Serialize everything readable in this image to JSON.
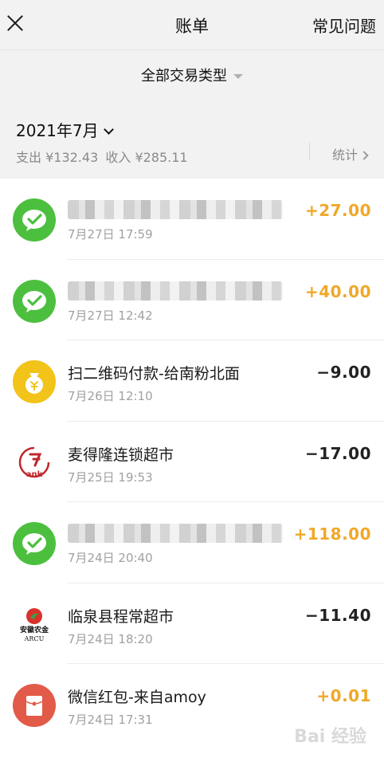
{
  "header": {
    "title": "账单",
    "faq": "常见问题"
  },
  "filter": {
    "label": "全部交易类型"
  },
  "summary": {
    "month": "2021年7月",
    "expense": "支出 ¥132.43",
    "income": "收入 ¥285.11",
    "stats": "统计"
  },
  "transactions": [
    {
      "title": "",
      "date": "7月27日 17:59",
      "amount": "+27.00",
      "icon": "wechat-icon"
    },
    {
      "title": "",
      "date": "7月27日 12:42",
      "amount": "+40.00",
      "icon": "wechat-icon"
    },
    {
      "title": "扫二维码付款-给南粉北面",
      "date": "7月26日 12:10",
      "amount": "−9.00",
      "icon": "money-bag-icon"
    },
    {
      "title": "麦得隆连锁超市",
      "date": "7月25日 19:53",
      "amount": "−17.00",
      "icon": "store-logo-icon"
    },
    {
      "title": "",
      "date": "7月24日 20:40",
      "amount": "+118.00",
      "icon": "wechat-icon"
    },
    {
      "title": "临泉县程常超市",
      "date": "7月24日 18:20",
      "amount": "−11.40",
      "icon": "bank-logo-icon"
    },
    {
      "title": "微信红包-来自amoy",
      "date": "7月24日 17:31",
      "amount": "+0.01",
      "icon": "red-packet-icon"
    }
  ],
  "bank_logo_text": {
    "line1": "安徽农金",
    "line2": "ARCU"
  },
  "store_logo_text": "ank",
  "watermark": "Bai 经验",
  "colors": {
    "income": "#f0a829",
    "expense": "#222222",
    "wechat": "#4cbf3f",
    "background": "#f2f2f2"
  }
}
